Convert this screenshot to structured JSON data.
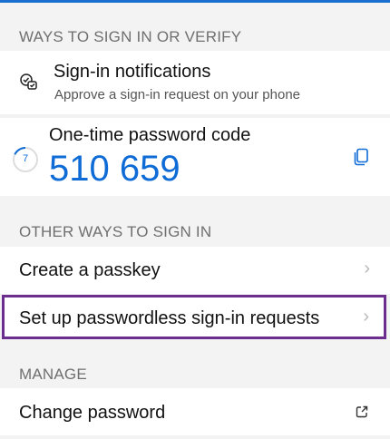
{
  "sections": {
    "verify": "WAYS TO SIGN IN OR VERIFY",
    "other": "OTHER WAYS TO SIGN IN",
    "manage": "MANAGE"
  },
  "notifications": {
    "title": "Sign-in notifications",
    "subtitle": "Approve a sign-in request on your phone"
  },
  "otp": {
    "title": "One-time password code",
    "code": "510 659",
    "seconds_left": "7",
    "countdown_fraction": 0.23
  },
  "other_items": [
    "Create a passkey",
    "Set up passwordless sign-in requests"
  ],
  "manage_items": [
    "Change password"
  ],
  "colors": {
    "accent": "#0f6cd6",
    "highlight": "#6b2e8f"
  }
}
